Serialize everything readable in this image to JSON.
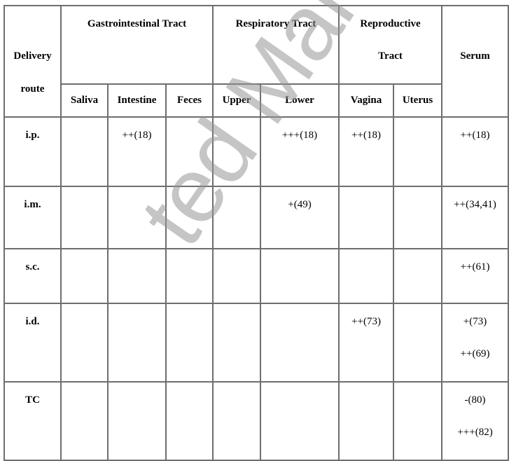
{
  "table": {
    "header": {
      "delivery_line1": "Delivery",
      "delivery_line2": "route",
      "groups": {
        "gi": "Gastrointestinal Tract",
        "resp": "Respiratory Tract",
        "repro_line1": "Reproductive",
        "repro_line2": "Tract",
        "serum": "Serum"
      },
      "subcolumns": [
        "Saliva",
        "Intestine",
        "Feces",
        "Upper",
        "Lower",
        "Vagina",
        "Uterus"
      ]
    },
    "rows": [
      {
        "route": "i.p.",
        "saliva": "",
        "intestine": "++(18)",
        "feces": "",
        "upper": "",
        "lower": "+++(18)",
        "vagina": "++(18)",
        "uterus": "",
        "serum": [
          "++(18)"
        ]
      },
      {
        "route": "i.m.",
        "saliva": "",
        "intestine": "",
        "feces": "",
        "upper": "",
        "lower": "+(49)",
        "vagina": "",
        "uterus": "",
        "serum": [
          "++(34,41)"
        ]
      },
      {
        "route": "s.c.",
        "saliva": "",
        "intestine": "",
        "feces": "",
        "upper": "",
        "lower": "",
        "vagina": "",
        "uterus": "",
        "serum": [
          "++(61)"
        ]
      },
      {
        "route": "i.d.",
        "saliva": "",
        "intestine": "",
        "feces": "",
        "upper": "",
        "lower": "",
        "vagina": "++(73)",
        "uterus": "",
        "serum": [
          "+(73)",
          "++(69)"
        ]
      },
      {
        "route": "TC",
        "saliva": "",
        "intestine": "",
        "feces": "",
        "upper": "",
        "lower": "",
        "vagina": "",
        "uterus": "",
        "serum": [
          "-(80)",
          "+++(82)"
        ]
      }
    ]
  },
  "watermark": "ted Manuscript"
}
